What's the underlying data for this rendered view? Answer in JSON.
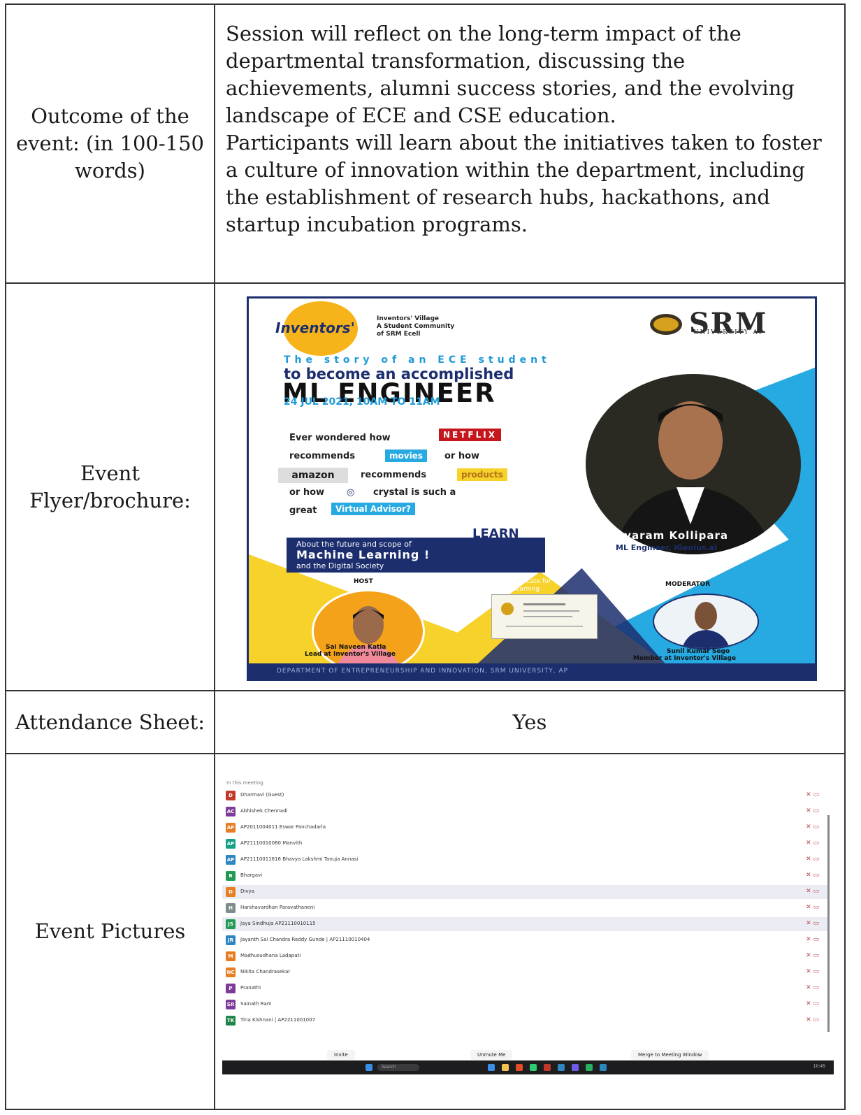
{
  "rows": {
    "outcome": {
      "label": "Outcome of the event: (in 100-150 words)",
      "paragraph1": "Session will reflect on the long-term impact of the departmental transformation, discussing the achievements, alumni success stories, and the evolving landscape of ECE and CSE education.",
      "paragraph2": "Participants will learn about the initiatives taken to foster a culture of innovation within the department, including the establishment of research hubs, hackathons, and startup incubation programs."
    },
    "flyer": {
      "label": "Event Flyer/brochure:"
    },
    "attendance": {
      "label": "Attendance Sheet:",
      "value": "Yes"
    },
    "pictures": {
      "label": "Event Pictures"
    }
  },
  "flyer": {
    "logo_word": "Inventors'",
    "logo_sub_1": "Inventors' Village",
    "logo_sub_2": "A Student Community",
    "logo_sub_3": "of SRM Ecell",
    "srm": "SRM",
    "srm_sub": "UNIVERSITY AP",
    "story": "The story of an ECE student",
    "accomplished": "to become an accomplished",
    "title": "ML ENGINEER",
    "date": "24 JUL 2021, 10AM TO 11AM",
    "q1": "Ever wondered how",
    "netflix": "NETFLIX",
    "q2": "recommends",
    "movies": "movies",
    "q3": "or how",
    "amazon": "amazon",
    "q4": "recommends",
    "products": "products",
    "q5": "or how",
    "crystal": "crystal is such a",
    "q6": "great",
    "advisor": "Virtual Advisor?",
    "learn": "LEARN",
    "learn_1": "About the future and scope of",
    "learn_2": "Machine Learning !",
    "learn_3": "and the Digital Society",
    "speaker_name": "Jayaram Kollipara",
    "speaker_role": "ML Engineer, iGenius.ai",
    "host_tag": "HOST",
    "host_name": "Sai Naveen Katla",
    "host_role": "Lead at Inventor's Village",
    "cert_1": "Earn a certificate for",
    "cert_2": "your learning",
    "moderator_tag": "MODERATOR",
    "moderator_name": "Sunil Kumar Sego",
    "moderator_role": "Member at Inventor's Village",
    "footer": "DEPARTMENT OF ENTREPRENEURSHIP AND INNOVATION, SRM UNIVERSITY, AP",
    "colors": {
      "navy": "#1c2e6e",
      "blue": "#27a9e1",
      "yellow": "#f6d22a",
      "netflix": "#c4161c"
    }
  },
  "screenshot": {
    "title": "In this meeting",
    "participants": [
      {
        "initials": "D",
        "name": "Dharmavi (Guest)",
        "color": "#c0392b"
      },
      {
        "initials": "AC",
        "name": "Abhishek Chennadi",
        "color": "#7d3c98"
      },
      {
        "initials": "AP",
        "name": "AP2011004011 Eswar Panchadarla",
        "color": "#e67e22"
      },
      {
        "initials": "AP",
        "name": "AP21110010060 Manvith",
        "color": "#16a085"
      },
      {
        "initials": "AP",
        "name": "AP21110011616 Bhavya Lakshmi Tanuja Annasi",
        "color": "#2e86c1"
      },
      {
        "initials": "B",
        "name": "Bhargavi",
        "color": "#229954"
      },
      {
        "initials": "D",
        "name": "Divya",
        "color": "#e67e22"
      },
      {
        "initials": "H",
        "name": "Harshavardhan Paravathaneni",
        "color": "#7f8c8d"
      },
      {
        "initials": "JS",
        "name": "Jaya Sindhuja AP21110010115",
        "color": "#229954"
      },
      {
        "initials": "JR",
        "name": "Jayanth Sai Chandra Reddy Gunde | AP21110010404",
        "color": "#2e86c1"
      },
      {
        "initials": "M",
        "name": "Madhusudhana Ladapati",
        "color": "#e67e22"
      },
      {
        "initials": "NC",
        "name": "Nikita Chandrasekar",
        "color": "#e67e22"
      },
      {
        "initials": "P",
        "name": "Pranathi",
        "color": "#7d3c98"
      },
      {
        "initials": "SR",
        "name": "Sainath Ram",
        "color": "#7d3c98"
      },
      {
        "initials": "TK",
        "name": "Tina Kishnani | AP2211001007",
        "color": "#1e8449"
      }
    ],
    "buttons": {
      "invite": "Invite",
      "unmute": "Unmute Me",
      "merge": "Merge to Meeting Window"
    },
    "taskbar_search": "Search",
    "taskbar_time": "10:45"
  }
}
